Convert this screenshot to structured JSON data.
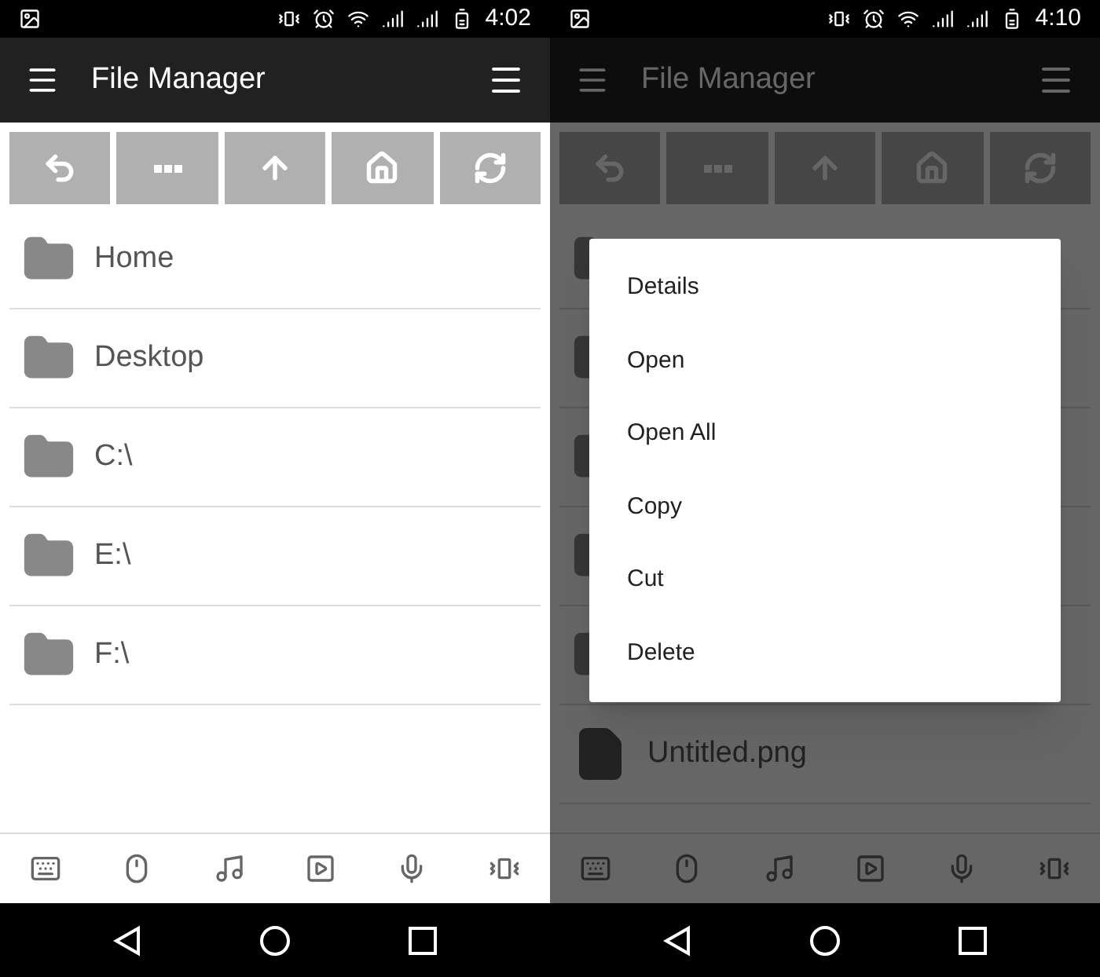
{
  "screens": [
    {
      "status_bar": {
        "time": "4:02"
      },
      "app_bar": {
        "title": "File Manager"
      },
      "dimmed": false,
      "items": [
        {
          "kind": "folder",
          "label": "Home"
        },
        {
          "kind": "folder",
          "label": "Desktop"
        },
        {
          "kind": "folder",
          "label": "C:\\"
        },
        {
          "kind": "folder",
          "label": "E:\\"
        },
        {
          "kind": "folder",
          "label": "F:\\"
        }
      ]
    },
    {
      "status_bar": {
        "time": "4:10"
      },
      "app_bar": {
        "title": "File Manager"
      },
      "dimmed": true,
      "items": [
        {
          "kind": "folder"
        },
        {
          "kind": "folder"
        },
        {
          "kind": "folder"
        },
        {
          "kind": "folder"
        },
        {
          "kind": "folder"
        },
        {
          "kind": "file",
          "label": "Untitled.png"
        }
      ],
      "context_menu": [
        "Details",
        "Open",
        "Open All",
        "Copy",
        "Cut",
        "Delete"
      ]
    }
  ]
}
